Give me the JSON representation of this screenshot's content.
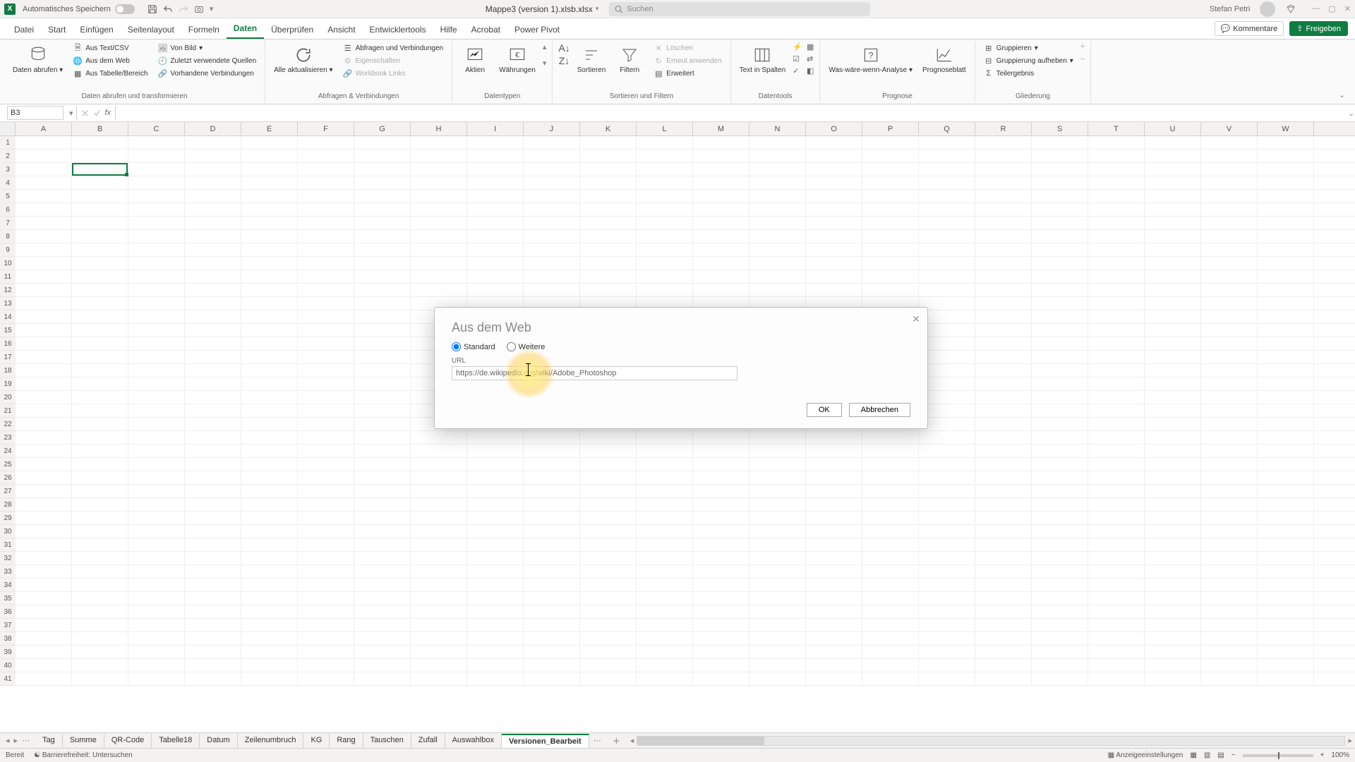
{
  "titlebar": {
    "autosave_label": "Automatisches Speichern",
    "filename": "Mappe3 (version 1).xlsb.xlsx",
    "search_placeholder": "Suchen",
    "username": "Stefan Petri"
  },
  "menutabs": {
    "items": [
      "Datei",
      "Start",
      "Einfügen",
      "Seitenlayout",
      "Formeln",
      "Daten",
      "Überprüfen",
      "Ansicht",
      "Entwicklertools",
      "Hilfe",
      "Acrobat",
      "Power Pivot"
    ],
    "active_index": 5,
    "comments": "Kommentare",
    "share": "Freigeben"
  },
  "ribbon": {
    "g1": {
      "big": "Daten abrufen",
      "items": [
        "Aus Text/CSV",
        "Aus dem Web",
        "Aus Tabelle/Bereich",
        "Von Bild",
        "Zuletzt verwendete Quellen",
        "Vorhandene Verbindungen"
      ],
      "label": "Daten abrufen und transformieren"
    },
    "g2": {
      "big": "Alle aktualisieren",
      "items": [
        "Abfragen und Verbindungen",
        "Eigenschaften",
        "Workbook Links"
      ],
      "label": "Abfragen & Verbindungen"
    },
    "g3": {
      "big1": "Aktien",
      "big2": "Währungen",
      "label": "Datentypen"
    },
    "g4": {
      "sort_btn": "Sortieren",
      "filter_btn": "Filtern",
      "items": [
        "Löschen",
        "Erneut anwenden",
        "Erweitert"
      ],
      "label": "Sortieren und Filtern"
    },
    "g5": {
      "big": "Text in Spalten",
      "label": "Datentools"
    },
    "g6": {
      "big1": "Was-wäre-wenn-Analyse",
      "big2": "Prognoseblatt",
      "label": "Prognose"
    },
    "g7": {
      "items": [
        "Gruppieren",
        "Gruppierung aufheben",
        "Teilergebnis"
      ],
      "label": "Gliederung"
    }
  },
  "namebox": {
    "value": "B3"
  },
  "columns": [
    "A",
    "B",
    "C",
    "D",
    "E",
    "F",
    "G",
    "H",
    "I",
    "J",
    "K",
    "L",
    "M",
    "N",
    "O",
    "P",
    "Q",
    "R",
    "S",
    "T",
    "U",
    "V",
    "W"
  ],
  "row_count": 41,
  "selected_cell": {
    "col": 1,
    "row": 2
  },
  "sheettabs": {
    "items": [
      "Tag",
      "Summe",
      "QR-Code",
      "Tabelle18",
      "Datum",
      "Zeilenumbruch",
      "KG",
      "Rang",
      "Tauschen",
      "Zufall",
      "Auswahlbox",
      "Versionen_Bearbeit"
    ],
    "active_index": 11
  },
  "statusbar": {
    "ready": "Bereit",
    "accessibility": "Barrierefreiheit: Untersuchen",
    "display_settings": "Anzeigeeinstellungen",
    "zoom": "100%"
  },
  "dialog": {
    "title": "Aus dem Web",
    "radio_standard": "Standard",
    "radio_weitere": "Weitere",
    "url_label": "URL",
    "url_value": "https://de.wikipedia.org/wiki/Adobe_Photoshop",
    "ok": "OK",
    "cancel": "Abbrechen"
  }
}
